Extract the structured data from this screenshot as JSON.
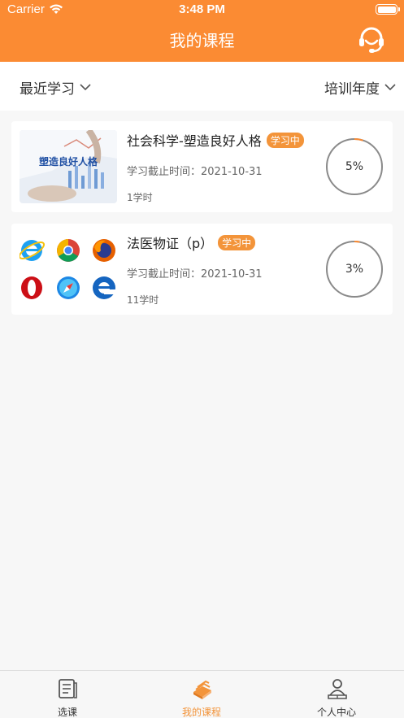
{
  "status_bar": {
    "carrier": "Carrier",
    "time": "3:48 PM"
  },
  "header": {
    "title": "我的课程",
    "service_icon": "customer-service-headset-icon"
  },
  "filters": {
    "left": "最近学习",
    "right": "培训年度"
  },
  "colors": {
    "brand": "#fb8b33",
    "badge": "#f3943a",
    "progress_track": "#8a8a8a"
  },
  "courses": [
    {
      "thumb_text": "塑造良好人格",
      "title": "社会科学-塑造良好人格",
      "badge": "学习中",
      "deadline": "学习截止时间：2021-10-31",
      "hours": "1学时",
      "progress_label": "5%",
      "progress": 0.05
    },
    {
      "thumb_icons": [
        "ie-icon",
        "chrome-icon",
        "firefox-icon",
        "opera-icon",
        "safari-icon",
        "edge-icon"
      ],
      "title": "法医物证（p）",
      "badge": "学习中",
      "deadline": "学习截止时间：2021-10-31",
      "hours": "11学时",
      "progress_label": "3%",
      "progress": 0.03
    }
  ],
  "tabbar": {
    "items": [
      {
        "label": "选课"
      },
      {
        "label": "我的课程",
        "active": true
      },
      {
        "label": "个人中心"
      }
    ]
  }
}
